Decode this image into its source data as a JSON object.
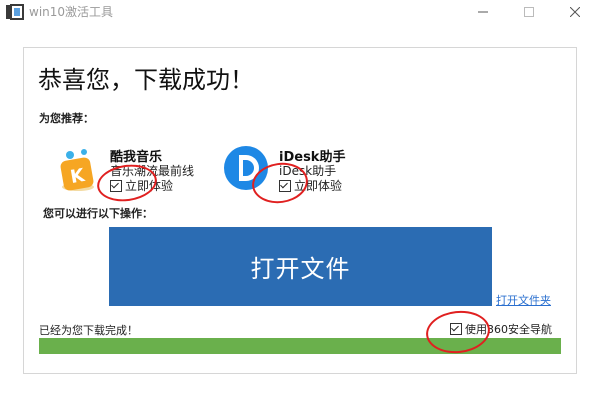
{
  "window": {
    "title": "win10激活工具",
    "icons": {
      "app": "hd-app-icon",
      "minimize": "minimize-icon",
      "maximize": "maximize-icon",
      "close": "close-icon"
    }
  },
  "main": {
    "headline": "恭喜您，下载成功！",
    "recommend_label": "为您推荐：",
    "apps": [
      {
        "name": "酷我音乐",
        "desc": "音乐潮流最前线",
        "checkbox_label": "立即体验",
        "checked": true,
        "icon": "kuwo-music-icon"
      },
      {
        "name": "iDesk助手",
        "desc": "iDesk助手",
        "checkbox_label": "立即体验",
        "checked": true,
        "icon": "idesk-icon"
      }
    ],
    "ops_label": "您可以进行以下操作：",
    "open_file_button": "打开文件",
    "open_folder_link": "打开文件夹",
    "status_text": "已经为您下载完成！",
    "nav_checkbox_label": "使用360安全导航",
    "nav_checked": true,
    "progress": 1.0,
    "colors": {
      "accent": "#2b6cb3",
      "progress": "#6ab04c",
      "annotation": "#e02020"
    }
  }
}
